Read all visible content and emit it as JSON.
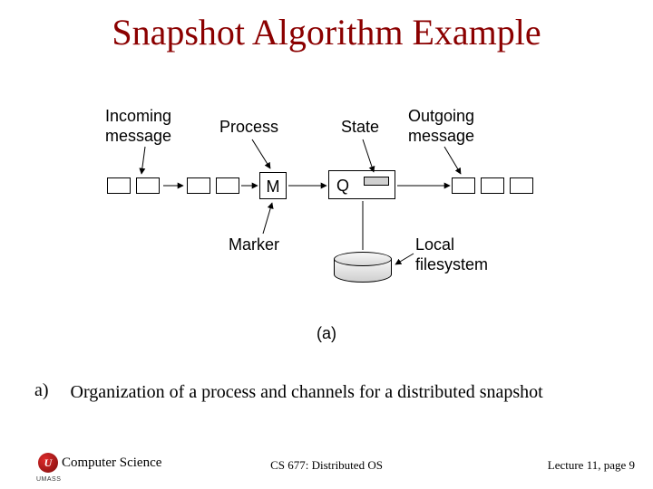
{
  "title": "Snapshot Algorithm Example",
  "labels": {
    "incoming": "Incoming\nmessage",
    "process": "Process",
    "state": "State",
    "outgoing": "Outgoing\nmessage",
    "marker": "Marker",
    "local_fs": "Local\nfilesystem",
    "m": "M",
    "q": "Q",
    "subfigure": "(a)"
  },
  "caption": {
    "letter": "a)",
    "text": "Organization of a process and channels for a distributed snapshot"
  },
  "footer": {
    "dept": "Computer Science",
    "course": "CS 677: Distributed OS",
    "lecture": "Lecture 11, page 9",
    "umass_initial": "U",
    "umass_sub": "UMASS"
  }
}
